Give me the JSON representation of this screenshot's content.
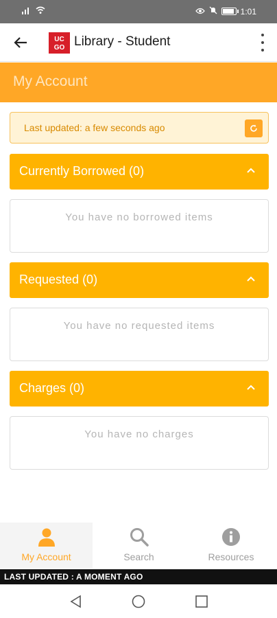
{
  "status_bar": {
    "left_icons": [
      "signal-icon",
      "wifi-icon"
    ],
    "right_icons": [
      "eye-icon",
      "mute-icon",
      "battery-icon"
    ],
    "time": "1:01"
  },
  "app_bar": {
    "logo_text": "UC GO",
    "title": "Library - Student",
    "back_icon": "arrow-left-icon",
    "menu_icon": "more-vertical-icon"
  },
  "page_header": {
    "title": "My Account"
  },
  "notice": {
    "text": "Last updated: a few seconds ago",
    "refresh_icon": "refresh-icon"
  },
  "sections": [
    {
      "title": "Currently Borrowed (0)",
      "empty_message": "You have no borrowed items"
    },
    {
      "title": "Requested (0)",
      "empty_message": "You have no requested items"
    },
    {
      "title": "Charges (0)",
      "empty_message": "You have no charges"
    }
  ],
  "bottom_nav": {
    "items": [
      {
        "label": "My Account",
        "icon": "user-icon",
        "active": true
      },
      {
        "label": "Search",
        "icon": "search-icon",
        "active": false
      },
      {
        "label": "Resources",
        "icon": "info-icon",
        "active": false
      }
    ]
  },
  "footer": {
    "text": "LAST UPDATED : A MOMENT AGO"
  },
  "system_nav": [
    "back-triangle-icon",
    "home-circle-icon",
    "recents-square-icon"
  ],
  "colors": {
    "accent": "#ffa726",
    "section": "#ffb300",
    "notice_bg": "#fff3d6"
  }
}
